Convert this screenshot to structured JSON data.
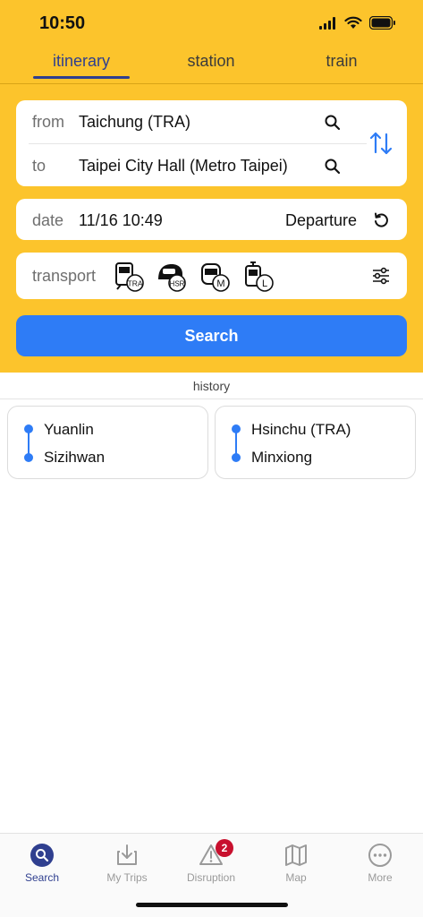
{
  "status_bar": {
    "time": "10:50"
  },
  "tabs": [
    {
      "label": "itinerary",
      "active": true
    },
    {
      "label": "station",
      "active": false
    },
    {
      "label": "train",
      "active": false
    }
  ],
  "route": {
    "from_label": "from",
    "from_value": "Taichung (TRA)",
    "to_label": "to",
    "to_value": "Taipei City Hall (Metro Taipei)"
  },
  "date": {
    "label": "date",
    "value": "11/16 10:49",
    "mode": "Departure"
  },
  "transport": {
    "label": "transport",
    "modes": [
      {
        "name": "train-tra-icon",
        "badge": "TRA"
      },
      {
        "name": "train-hsr-icon",
        "badge": "HSR"
      },
      {
        "name": "train-metro-icon",
        "badge": "M"
      },
      {
        "name": "train-light-rail-icon",
        "badge": "L"
      }
    ]
  },
  "search_button": "Search",
  "history": {
    "label": "history",
    "items": [
      {
        "from": "Yuanlin",
        "to": "Sizihwan"
      },
      {
        "from": "Hsinchu (TRA)",
        "to": "Minxiong"
      }
    ]
  },
  "bottom_nav": [
    {
      "label": "Search",
      "icon": "search-icon",
      "active": true
    },
    {
      "label": "My Trips",
      "icon": "download-tray-icon",
      "active": false
    },
    {
      "label": "Disruption",
      "icon": "warning-icon",
      "active": false,
      "badge": "2"
    },
    {
      "label": "Map",
      "icon": "map-icon",
      "active": false
    },
    {
      "label": "More",
      "icon": "more-icon",
      "active": false
    }
  ],
  "colors": {
    "header_bg": "#fcc42c",
    "accent_blue": "#2e7cf6",
    "tab_active": "#2f3f8f",
    "badge_red": "#c8102e"
  }
}
